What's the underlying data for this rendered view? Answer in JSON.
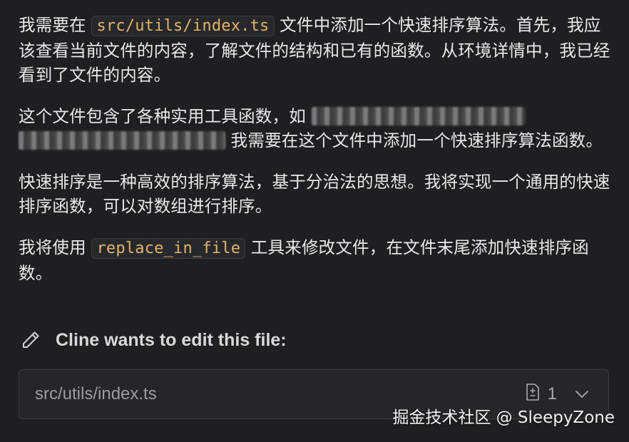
{
  "message": {
    "p1": {
      "before": "我需要在 ",
      "code": "src/utils/index.ts",
      "after": " 文件中添加一个快速排序算法。首先，我应该查看当前文件的内容，了解文件的结构和已有的函数。从环境详情中，我已经看到了文件的内容。"
    },
    "p2": {
      "before": "这个文件包含了各种实用工具函数，如 ",
      "after": " 我需要在这个文件中添加一个快速排序算法函数。"
    },
    "p3": "快速排序是一种高效的排序算法，基于分治法的思想。我将实现一个通用的快速排序函数，可以对数组进行排序。",
    "p4": {
      "before": "我将使用 ",
      "code": "replace_in_file",
      "after": " 工具来修改文件，在文件末尾添加快速排序函数。"
    }
  },
  "edit_request": {
    "title": "Cline wants to edit this file:",
    "icon": "pencil-icon"
  },
  "file_card": {
    "path": "src/utils/index.ts",
    "count": "1",
    "icons": [
      "diff-file-icon",
      "chevron-down-icon"
    ]
  },
  "watermark": "掘金技术社区 @ SleepyZone",
  "colors": {
    "background": "#1e1f22",
    "code_text": "#e3b464",
    "text": "#e8e8e8"
  }
}
